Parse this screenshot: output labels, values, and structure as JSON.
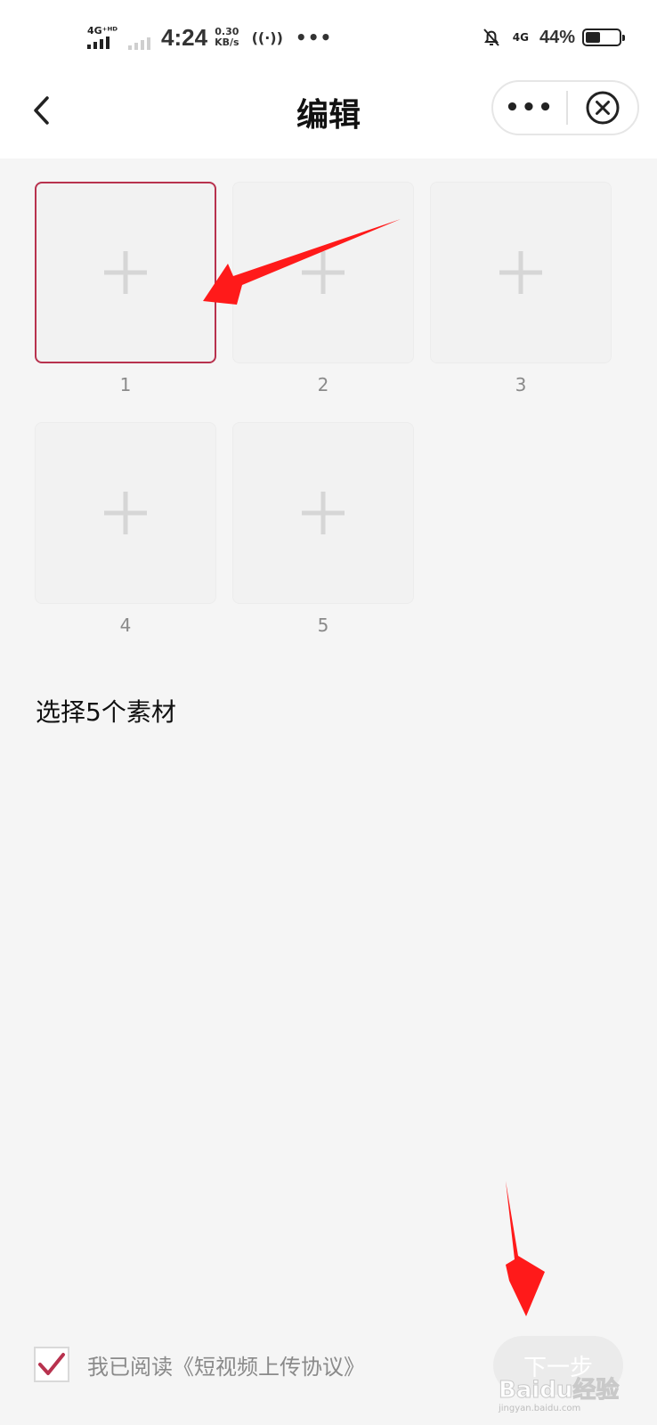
{
  "status_bar": {
    "sim1_tag": "4G⁺ᴴᴰ",
    "time": "4:24",
    "speed_value": "0.30",
    "speed_unit": "KB/s",
    "hotspot": "((·))",
    "dots": "•••",
    "net_tag": "4G",
    "battery_pct": "44%",
    "battery_level": 0.44
  },
  "header": {
    "title": "编辑",
    "more": "•••"
  },
  "tiles": [
    {
      "number": "1"
    },
    {
      "number": "2"
    },
    {
      "number": "3"
    },
    {
      "number": "4"
    },
    {
      "number": "5"
    }
  ],
  "hint": "选择5个素材",
  "footer": {
    "agreement": "我已阅读《短视频上传协议》",
    "next_label": "下一步",
    "watermark": "Baidu经验",
    "watermark_sub": "jingyan.baidu.com"
  },
  "colors": {
    "accent": "#b8324e",
    "arrow": "#ff1a1a",
    "background": "#f5f5f5"
  }
}
